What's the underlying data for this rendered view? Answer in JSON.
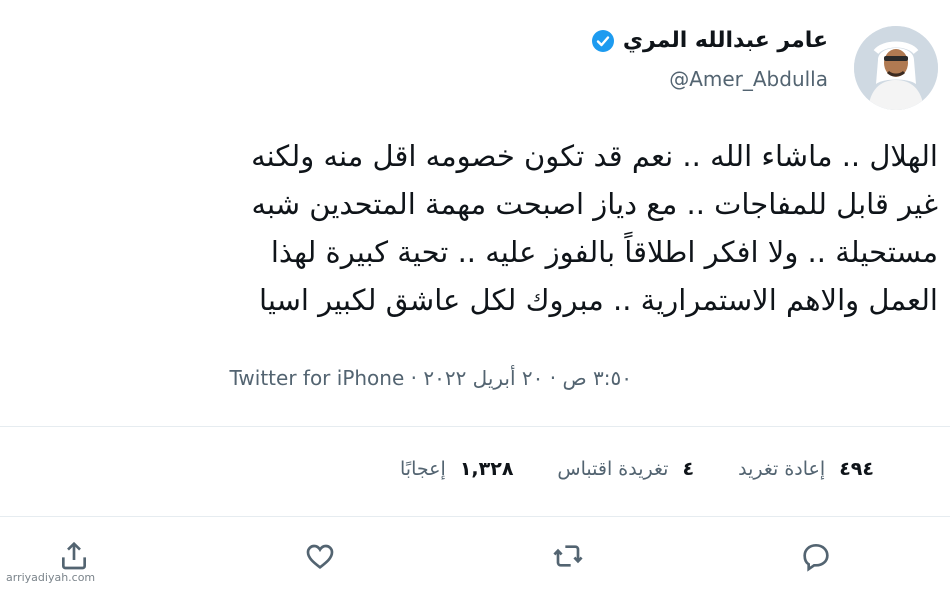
{
  "profile": {
    "display_name": "عامر عبدالله المري",
    "handle": "@Amer_Abdulla",
    "verified": true,
    "avatar_icon": "profile-avatar"
  },
  "tweet": {
    "lines": [
      "الهلال .. ماشاء الله .. نعم قد تكون خصومه اقل منه ولكنه",
      "غير قابل للمفاجات .. مع دياز اصبحت مهمة المتحدين شبه",
      "مستحيلة .. ولا افكر اطلاقاً بالفوز عليه .. تحية كبيرة لهذا",
      "العمل والاهم الاستمرارية .. مبروك لكل عاشق لكبير اسيا"
    ],
    "time": "٣:٥٠ ص",
    "date": "٢٠ أبريل ٢٠٢٢",
    "separator": "·",
    "source": "Twitter for iPhone"
  },
  "stats": {
    "retweets_count": "٤٩٤",
    "retweets_label": "إعادة تغريد",
    "quotes_count": "٤",
    "quotes_label": "تغريدة اقتباس",
    "likes_count": "١,٣٢٨",
    "likes_label": "إعجابًا"
  },
  "actions": {
    "reply_icon": "reply-icon",
    "retweet_icon": "retweet-icon",
    "like_icon": "like-icon",
    "share_icon": "share-icon"
  },
  "watermark": "arriyadiyah.com",
  "colors": {
    "verified_blue": "#1d9bf0",
    "secondary_text": "#536471",
    "divider": "#e6ecf0"
  }
}
